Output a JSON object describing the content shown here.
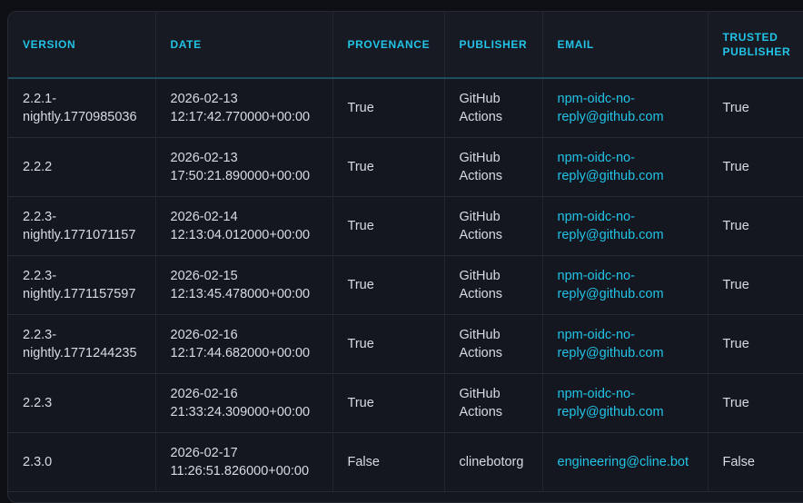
{
  "table": {
    "headers": {
      "version": "VERSION",
      "date": "DATE",
      "provenance": "PROVENANCE",
      "publisher": "PUBLISHER",
      "email": "EMAIL",
      "trusted_publisher": "TRUSTED PUBLISHER"
    },
    "rows": [
      {
        "version": "2.2.1-nightly.1770985036",
        "date": "2026-02-13 12:17:42.770000+00:00",
        "provenance": "True",
        "publisher": "GitHub Actions",
        "email": "npm-oidc-no-reply@github.com",
        "trusted": "True"
      },
      {
        "version": "2.2.2",
        "date": "2026-02-13 17:50:21.890000+00:00",
        "provenance": "True",
        "publisher": "GitHub Actions",
        "email": "npm-oidc-no-reply@github.com",
        "trusted": "True"
      },
      {
        "version": "2.2.3-nightly.1771071157",
        "date": "2026-02-14 12:13:04.012000+00:00",
        "provenance": "True",
        "publisher": "GitHub Actions",
        "email": "npm-oidc-no-reply@github.com",
        "trusted": "True"
      },
      {
        "version": "2.2.3-nightly.1771157597",
        "date": "2026-02-15 12:13:45.478000+00:00",
        "provenance": "True",
        "publisher": "GitHub Actions",
        "email": "npm-oidc-no-reply@github.com",
        "trusted": "True"
      },
      {
        "version": "2.2.3-nightly.1771244235",
        "date": "2026-02-16 12:17:44.682000+00:00",
        "provenance": "True",
        "publisher": "GitHub Actions",
        "email": "npm-oidc-no-reply@github.com",
        "trusted": "True"
      },
      {
        "version": "2.2.3",
        "date": "2026-02-16 21:33:24.309000+00:00",
        "provenance": "True",
        "publisher": "GitHub Actions",
        "email": "npm-oidc-no-reply@github.com",
        "trusted": "True"
      },
      {
        "version": "2.3.0",
        "date": "2026-02-17 11:26:51.826000+00:00",
        "provenance": "False",
        "publisher": "clinebotorg",
        "email": "engineering@cline.bot",
        "trusted": "False"
      }
    ]
  },
  "colors": {
    "accent": "#22c3e6",
    "background": "#0d0f14",
    "panel": "#14171f",
    "text": "#d8dbe0"
  }
}
